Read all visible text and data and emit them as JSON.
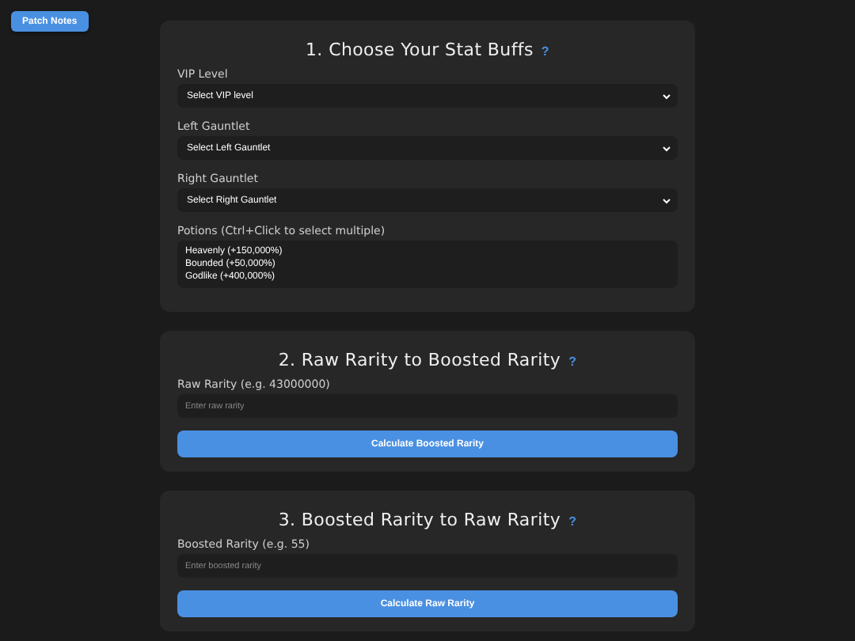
{
  "patch_notes_button": "Patch Notes",
  "cards": [
    {
      "title": "1. Choose Your Stat Buffs",
      "help": "?",
      "fields": [
        {
          "kind": "select",
          "label": "VIP Level",
          "value": "Select VIP level"
        },
        {
          "kind": "select",
          "label": "Left Gauntlet",
          "value": "Select Left Gauntlet"
        },
        {
          "kind": "select",
          "label": "Right Gauntlet",
          "value": "Select Right Gauntlet"
        },
        {
          "kind": "listbox",
          "label": "Potions (Ctrl+Click to select multiple)",
          "options": [
            "Heavenly (+150,000%)",
            "Bounded (+50,000%)",
            "Godlike (+400,000%)"
          ]
        }
      ]
    },
    {
      "title": "2. Raw Rarity to Boosted Rarity",
      "help": "?",
      "fields": [
        {
          "kind": "input",
          "label": "Raw Rarity (e.g. 43000000)",
          "placeholder": "Enter raw rarity"
        }
      ],
      "button": "Calculate Boosted Rarity"
    },
    {
      "title": "3. Boosted Rarity to Raw Rarity",
      "help": "?",
      "fields": [
        {
          "kind": "input",
          "label": "Boosted Rarity (e.g. 55)",
          "placeholder": "Enter boosted rarity"
        }
      ],
      "button": "Calculate Raw Rarity"
    }
  ]
}
